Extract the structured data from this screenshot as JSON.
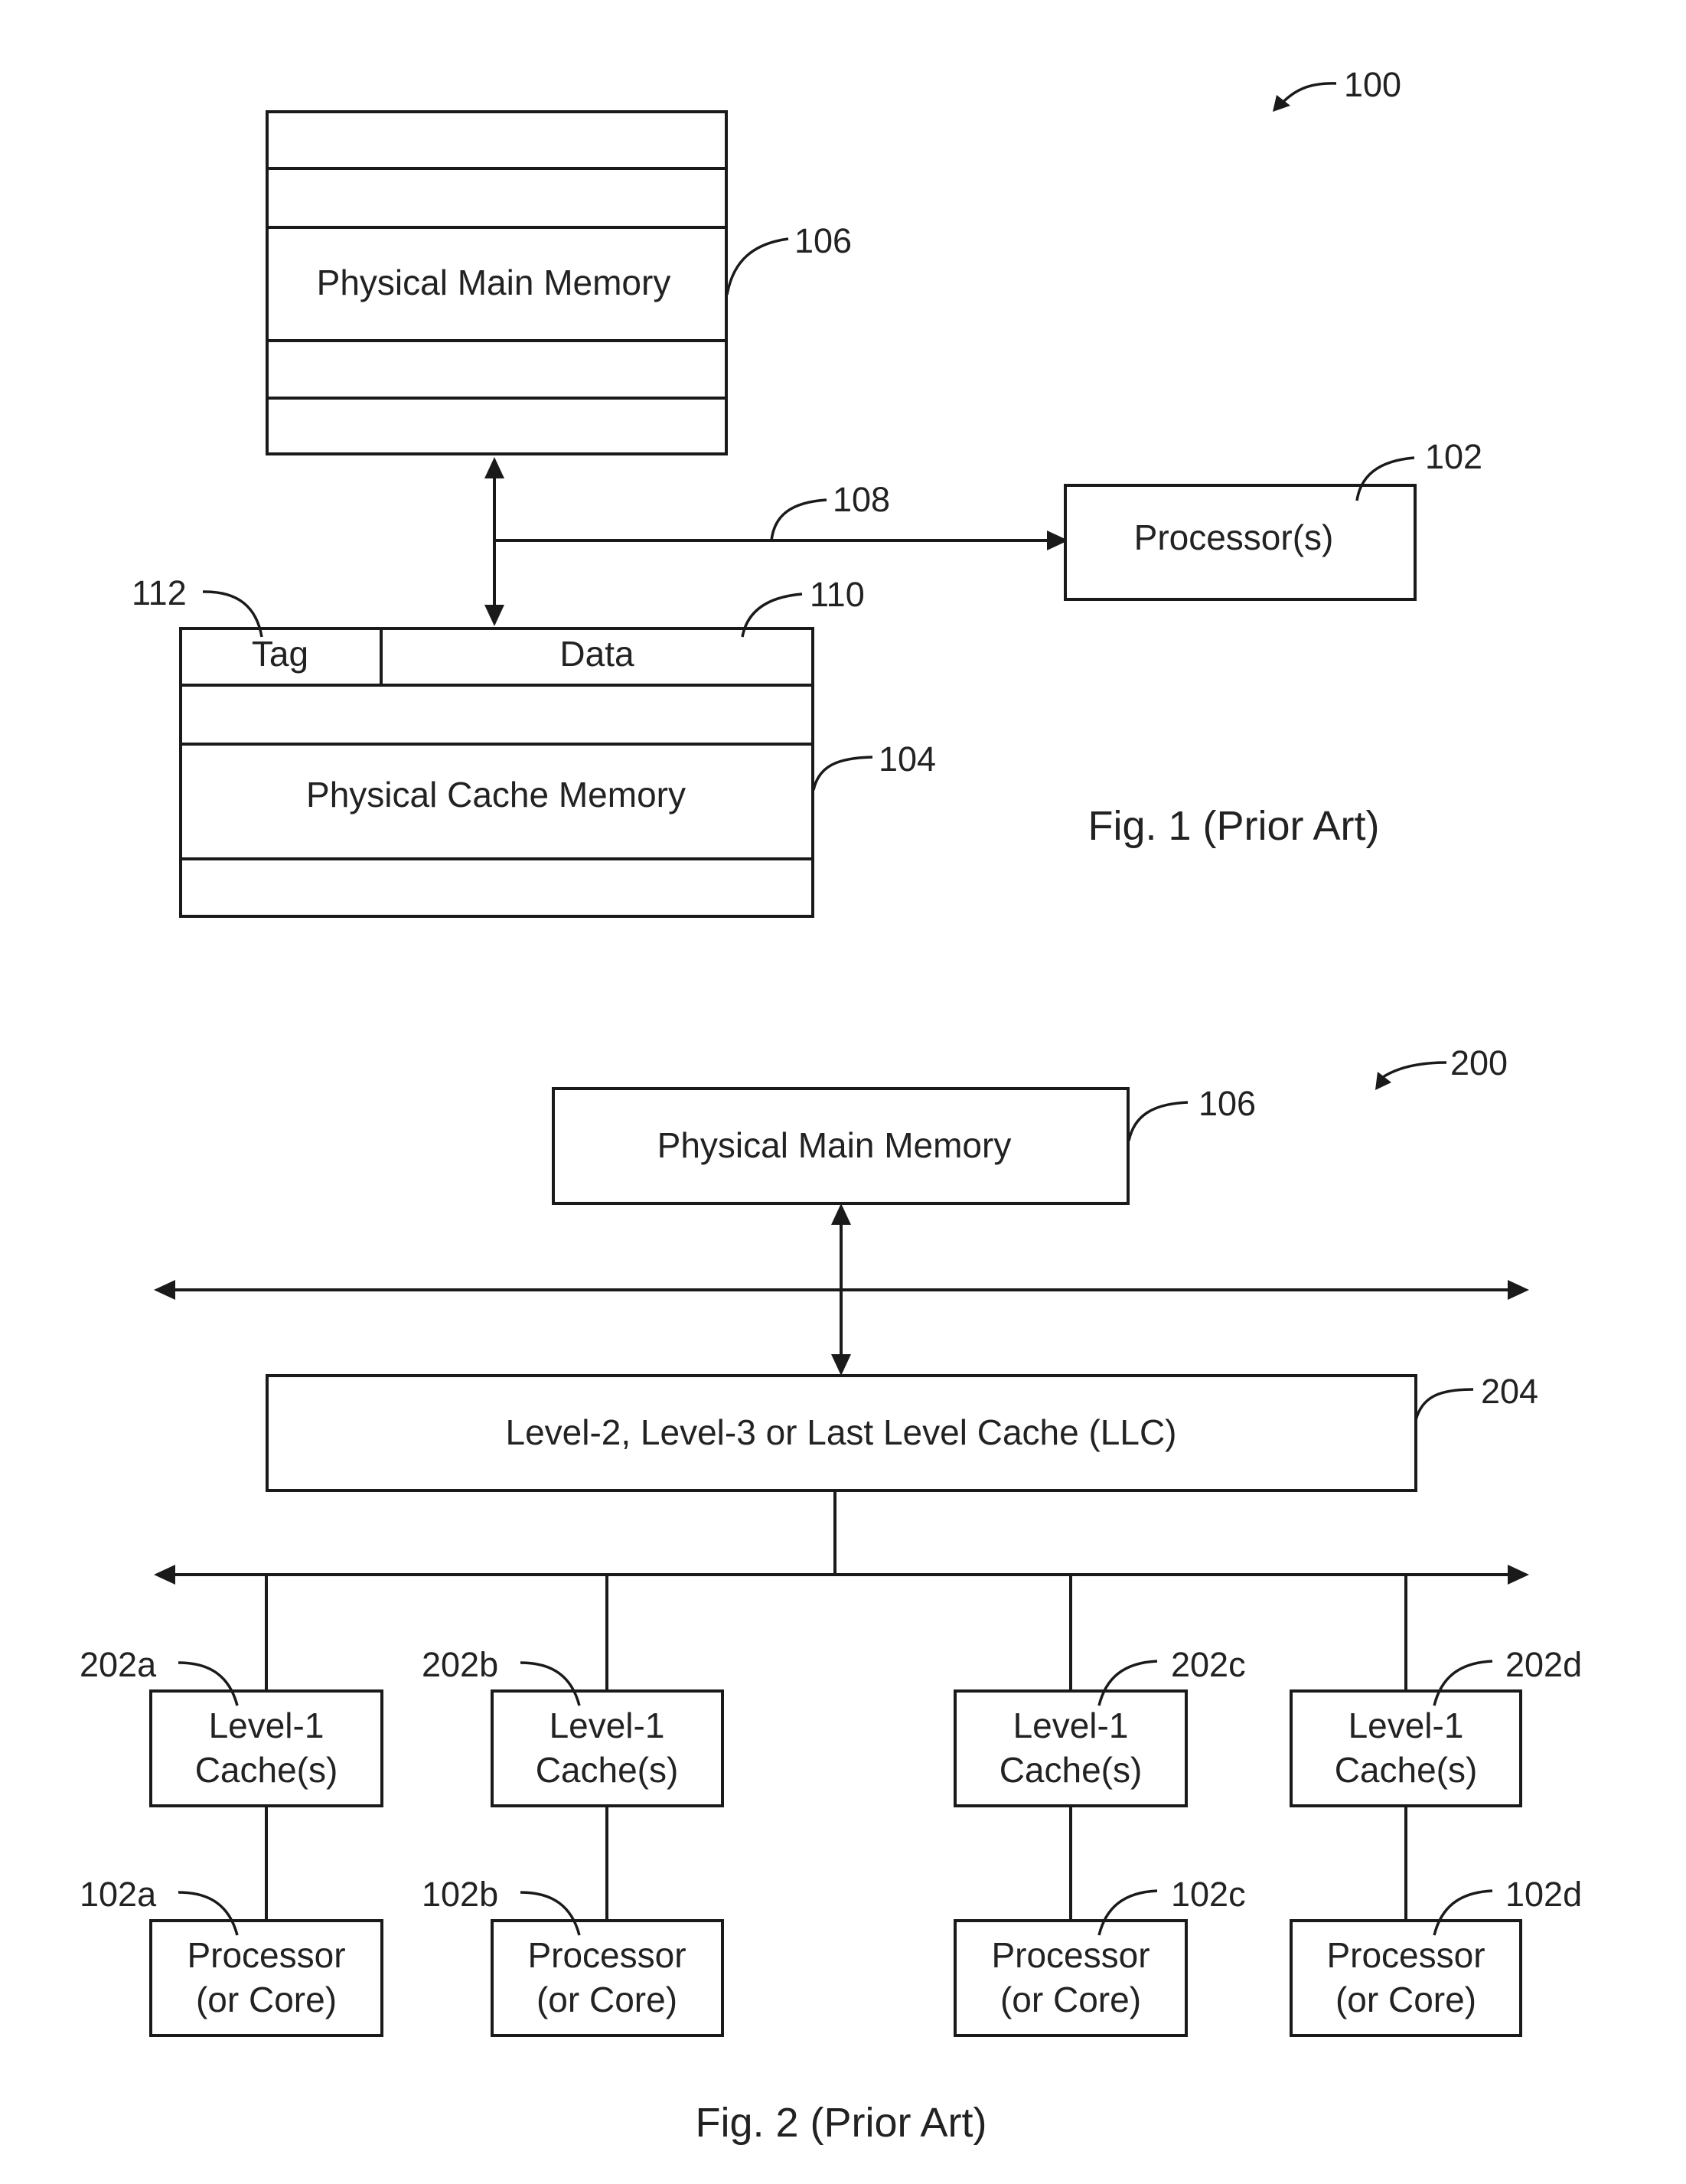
{
  "fig1": {
    "ref_label": "100",
    "main_memory": {
      "label": "Physical Main Memory",
      "ref": "106"
    },
    "bus": {
      "ref": "108"
    },
    "processor": {
      "label": "Processor(s)",
      "ref": "102"
    },
    "cache": {
      "label": "Physical Cache Memory",
      "ref": "104",
      "tag_label": "Tag",
      "tag_ref": "112",
      "data_label": "Data",
      "data_ref": "110"
    },
    "caption": "Fig. 1 (Prior Art)"
  },
  "fig2": {
    "ref_label": "200",
    "main_memory": {
      "label": "Physical Main Memory",
      "ref": "106"
    },
    "llc": {
      "label": "Level-2, Level-3 or Last Level Cache (LLC)",
      "ref": "204"
    },
    "l1_caches": [
      {
        "line1": "Level-1",
        "line2": "Cache(s)",
        "ref": "202a"
      },
      {
        "line1": "Level-1",
        "line2": "Cache(s)",
        "ref": "202b"
      },
      {
        "line1": "Level-1",
        "line2": "Cache(s)",
        "ref": "202c"
      },
      {
        "line1": "Level-1",
        "line2": "Cache(s)",
        "ref": "202d"
      }
    ],
    "processors": [
      {
        "line1": "Processor",
        "line2": "(or Core)",
        "ref": "102a"
      },
      {
        "line1": "Processor",
        "line2": "(or Core)",
        "ref": "102b"
      },
      {
        "line1": "Processor",
        "line2": "(or Core)",
        "ref": "102c"
      },
      {
        "line1": "Processor",
        "line2": "(or Core)",
        "ref": "102d"
      }
    ],
    "caption": "Fig. 2 (Prior Art)"
  }
}
